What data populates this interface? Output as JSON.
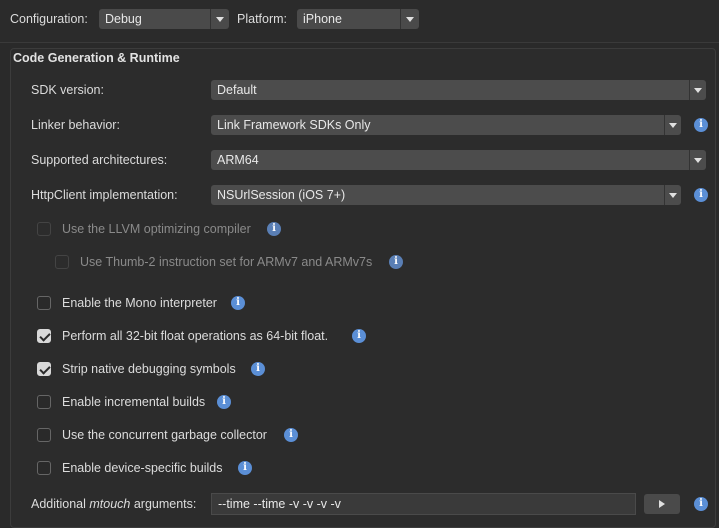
{
  "toolbar": {
    "configuration_label": "Configuration:",
    "configuration_value": "Debug",
    "platform_label": "Platform:",
    "platform_value": "iPhone"
  },
  "section": {
    "title": "Code Generation & Runtime",
    "sdk_version": {
      "label": "SDK version:",
      "value": "Default"
    },
    "linker": {
      "label": "Linker behavior:",
      "value": "Link Framework SDKs Only"
    },
    "architectures": {
      "label": "Supported architectures:",
      "value": "ARM64"
    },
    "httpclient": {
      "label": "HttpClient implementation:",
      "value": "NSUrlSession (iOS 7+)"
    },
    "checkboxes": [
      {
        "label": "Use the LLVM optimizing compiler",
        "checked": false,
        "enabled": false
      },
      {
        "label": "Use Thumb-2 instruction set for ARMv7 and ARMv7s",
        "checked": false,
        "enabled": false
      },
      {
        "label": "Enable the Mono interpreter",
        "checked": false,
        "enabled": true
      },
      {
        "label": "Perform all 32-bit float operations as 64-bit float.",
        "checked": true,
        "enabled": true
      },
      {
        "label": "Strip native debugging symbols",
        "checked": true,
        "enabled": true
      },
      {
        "label": "Enable incremental builds",
        "checked": false,
        "enabled": true
      },
      {
        "label": "Use the concurrent garbage collector",
        "checked": false,
        "enabled": true
      },
      {
        "label": "Enable device-specific builds",
        "checked": false,
        "enabled": true
      }
    ],
    "mtouch": {
      "label_prefix": "Additional ",
      "label_italic": "mtouch",
      "label_suffix": " arguments:",
      "value": "--time --time -v -v -v -v"
    }
  },
  "colors": {
    "info": "#5b8fd6",
    "background": "#2a2a2a"
  },
  "icons": {
    "info": "info-icon",
    "dropdown": "chevron-down-icon",
    "run": "play-icon"
  }
}
